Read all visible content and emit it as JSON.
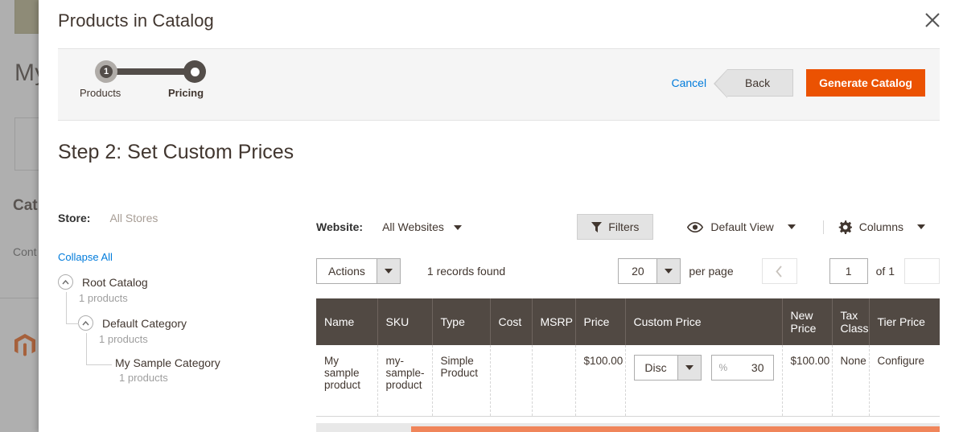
{
  "background": {
    "title": "My",
    "catalog_heading": "Cat",
    "content_text": "Cont",
    "logo_name": "magento-logo"
  },
  "modal": {
    "title": "Products in Catalog",
    "close_label": "×"
  },
  "stepper": {
    "steps": [
      {
        "number": "1",
        "label": "Products",
        "state": "done"
      },
      {
        "number": "2",
        "label": "Pricing",
        "state": "active"
      }
    ]
  },
  "header_actions": {
    "cancel_label": "Cancel",
    "back_label": "Back",
    "generate_label": "Generate Catalog",
    "accent_color": "#eb5202",
    "link_color": "#007bdb"
  },
  "step_title": "Step 2: Set Custom Prices",
  "store_filter": {
    "label": "Store:",
    "value": "All Stores"
  },
  "tree": {
    "collapse_all_label": "Collapse All",
    "nodes": [
      {
        "name": "Root Catalog",
        "count": "1 products",
        "level": 1
      },
      {
        "name": "Default Category",
        "count": "1 products",
        "level": 2
      },
      {
        "name": "My Sample Category",
        "count": "1 products",
        "level": 3
      }
    ]
  },
  "grid_toolbar": {
    "website_label": "Website:",
    "website_value": "All Websites",
    "filters_label": "Filters",
    "view_label": "Default View",
    "columns_label": "Columns",
    "actions_label": "Actions",
    "records_found": "1 records found",
    "per_page_value": "20",
    "per_page_label": "per page",
    "page_value": "1",
    "of_label": "of 1"
  },
  "grid": {
    "columns": [
      "Name",
      "SKU",
      "Type",
      "Cost",
      "MSRP",
      "Price",
      "Custom Price",
      "New Price",
      "Tax Class",
      "Tier Price"
    ],
    "rows": [
      {
        "name": "My sample product",
        "sku": "my-sample-product",
        "type": "Simple Product",
        "cost": "",
        "msrp": "",
        "price": "$100.00",
        "custom_price": {
          "mode": "Disc",
          "unit": "%",
          "amount": "30"
        },
        "new_price": "$100.00",
        "tax_class": "None",
        "tier_price": "Configure"
      }
    ]
  }
}
